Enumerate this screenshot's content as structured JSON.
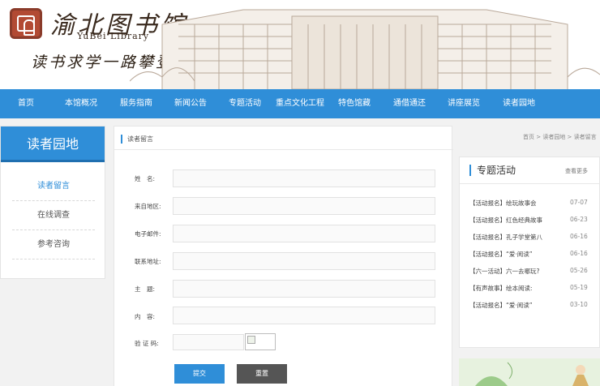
{
  "header": {
    "logo_cn": "渝北图书馆",
    "logo_en": "YuBei Library",
    "slogan": "读书求学一路攀登向上"
  },
  "nav": {
    "items": [
      "首页",
      "本馆概况",
      "服务指南",
      "新闻公告",
      "专题活动",
      "重点文化工程",
      "特色馆藏",
      "通借通还",
      "讲座展览",
      "读者园地"
    ]
  },
  "sidebar": {
    "title": "读者园地",
    "items": [
      "读者留言",
      "在线调查",
      "参考咨询"
    ]
  },
  "main": {
    "title": "读者留言",
    "breadcrumb": "首页 > 读者园地 > 读者留言",
    "labels": {
      "name": "姓　名:",
      "region": "来自地区:",
      "email": "电子邮件:",
      "address": "联系地址:",
      "subject": "主　题:",
      "content": "内　容:",
      "captcha": "验 证 码:"
    },
    "submit_label": "提交",
    "reset_label": "重置"
  },
  "right": {
    "title": "专题活动",
    "more": "查看更多",
    "news": [
      {
        "title": "【活动报名】绘玩故事会",
        "date": "07-07"
      },
      {
        "title": "【活动报名】红色经典故事",
        "date": "06-23"
      },
      {
        "title": "【活动报名】孔子学堂第八",
        "date": "06-16"
      },
      {
        "title": "【活动报名】“爱·阅读”",
        "date": "06-16"
      },
      {
        "title": "【六一活动】六一去哪玩?",
        "date": "05-26"
      },
      {
        "title": "【有声故事】绘本阅读:",
        "date": "05-19"
      },
      {
        "title": "【活动报名】“爱·阅读”",
        "date": "03-10"
      }
    ]
  },
  "colors": {
    "accent": "#2f8ed8",
    "nav_bg": "#2f8ed8",
    "reset_button": "#555555"
  }
}
